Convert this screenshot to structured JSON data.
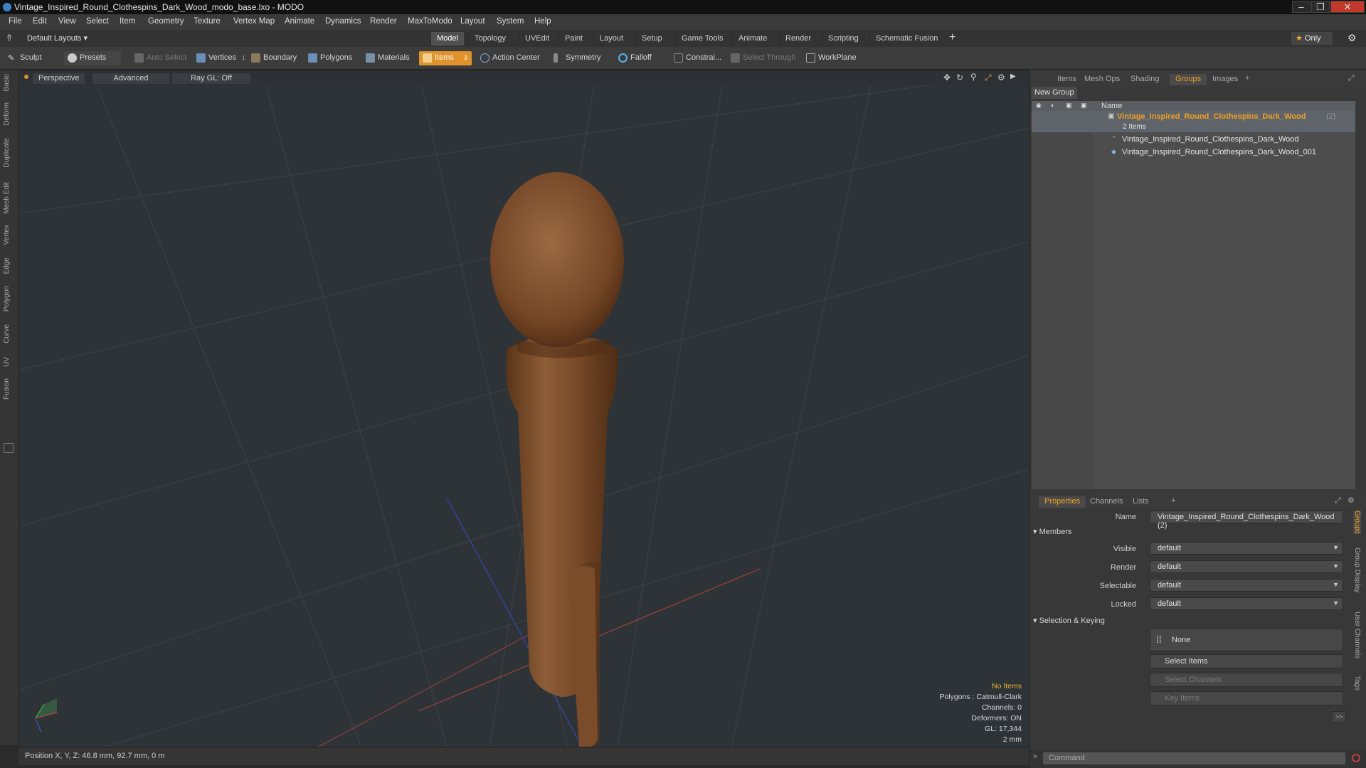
{
  "window": {
    "title": "Vintage_Inspired_Round_Clothespins_Dark_Wood_modo_base.lxo - MODO"
  },
  "menubar": [
    "File",
    "Edit",
    "View",
    "Select",
    "Item",
    "Geometry",
    "Texture",
    "Vertex Map",
    "Animate",
    "Dynamics",
    "Render",
    "MaxToModo",
    "Layout",
    "System",
    "Help"
  ],
  "layout": {
    "label": "Default Layouts",
    "only": "Only"
  },
  "modetabs": {
    "items": [
      "Model",
      "Topology",
      "UVEdit",
      "Paint",
      "Layout",
      "Setup",
      "Game Tools",
      "Animate",
      "Render",
      "Scripting",
      "Schematic Fusion"
    ],
    "active": "Model",
    "add": "+"
  },
  "toolbar": {
    "sculpt": "Sculpt",
    "presets": "Presets",
    "auto_select": "Auto Select",
    "vertices": "Vertices",
    "vertices_count": "1",
    "boundary": "Boundary",
    "polygons": "Polygons",
    "materials": "Materials",
    "items": "Items",
    "items_count": "3",
    "action_center": "Action Center",
    "symmetry": "Symmetry",
    "falloff": "Falloff",
    "constrain": "Constrai...",
    "select_through": "Select Through",
    "workplane": "WorkPlane"
  },
  "lefttabs": [
    "Basic",
    "Deform",
    "Duplicate",
    "Mesh Edit",
    "Vertex",
    "Edge",
    "Polygon",
    "Curve",
    "UV",
    "Fusion"
  ],
  "viewport": {
    "perspective": "Perspective",
    "advanced": "Advanced",
    "raygl": "Ray GL: Off",
    "hud": {
      "no_items": "No Items",
      "polygons": "Polygons : Catmull-Clark",
      "channels": "Channels: 0",
      "deformers": "Deformers: ON",
      "gl": "GL: 17,344",
      "unit": "2 mm"
    }
  },
  "status": {
    "position": "Position X, Y, Z:  46.8 mm, 92.7 mm, 0 m"
  },
  "panel": {
    "tabs": [
      "Items",
      "Mesh Ops",
      "Shading",
      "Groups",
      "Images"
    ],
    "active_tab": "Groups",
    "new_group": "New Group",
    "name_col": "Name",
    "group_name": "Vintage_Inspired_Round_Clothespins_Dark_Wood",
    "group_count": "(2)",
    "items_count": "2 Items",
    "children": [
      "Vintage_Inspired_Round_Clothespins_Dark_Wood",
      "Vintage_Inspired_Round_Clothespins_Dark_Wood_001"
    ]
  },
  "properties": {
    "tabs": [
      "Properties",
      "Channels",
      "Lists"
    ],
    "active_tab": "Properties",
    "name_label": "Name",
    "name_value": "Vintage_Inspired_Round_Clothespins_Dark_Wood (2)",
    "members": "Members",
    "visible_label": "Visible",
    "visible": "default",
    "render_label": "Render",
    "render": "default",
    "selectable_label": "Selectable",
    "selectable": "default",
    "locked_label": "Locked",
    "locked": "default",
    "selection_keying": "Selection & Keying",
    "none": "None",
    "select_items": "Select Items",
    "select_channels": "Select Channels",
    "key_items": "Key Items",
    "more": ">>",
    "side_tabs": [
      "Groups",
      "Group Display",
      "User Channels",
      "Tags"
    ]
  },
  "command": {
    "placeholder": "Command"
  },
  "colors": {
    "accent": "#f0a020",
    "viewport_bg": "#2e3338",
    "wood": "#8a5a36"
  }
}
